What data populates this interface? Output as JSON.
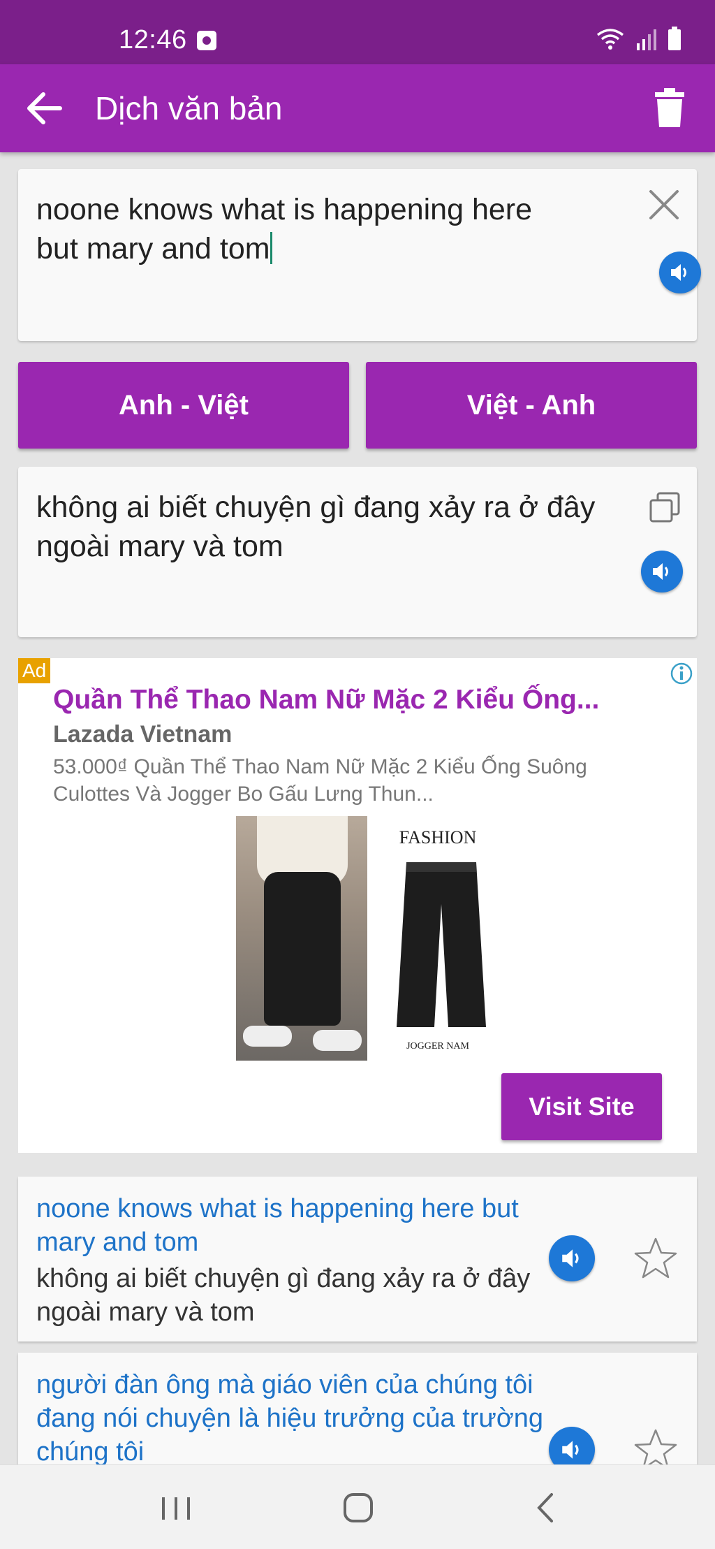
{
  "status_bar": {
    "time": "12:46"
  },
  "app_bar": {
    "title": "Dịch văn bản"
  },
  "input": {
    "text": "noone knows what is happening here\nbut mary and tom"
  },
  "language_buttons": {
    "en_vi": "Anh - Việt",
    "vi_en": "Việt - Anh"
  },
  "output": {
    "text": "không ai biết chuyện gì đang xảy ra ở đây ngoài mary và tom"
  },
  "ad": {
    "badge": "Ad",
    "title": "Quần Thể Thao Nam Nữ Mặc 2 Kiểu Ống...",
    "advertiser": "Lazada Vietnam",
    "description": "53.000₫ Quần Thể Thao Nam Nữ Mặc 2 Kiểu Ống Suông Culottes Và Jogger Bo Gấu Lưng Thun...",
    "image_label_top": "FASHION",
    "image_label_bottom": "JOGGER NAM",
    "cta": "Visit Site"
  },
  "history": [
    {
      "source": "noone knows what is happening here but mary and tom",
      "target": "không ai biết chuyện gì đang xảy ra ở đây ngoài mary và tom"
    },
    {
      "source": "người đàn ông mà giáo viên của chúng tôi đang nói chuyện là hiệu trưởng của trường chúng tôi",
      "target": ""
    }
  ],
  "colors": {
    "primary": "#9a27b0",
    "status_bar": "#7b1f8a",
    "speak": "#1e78d7",
    "history_source": "#1e73c8",
    "ad_badge": "#e8a100"
  }
}
